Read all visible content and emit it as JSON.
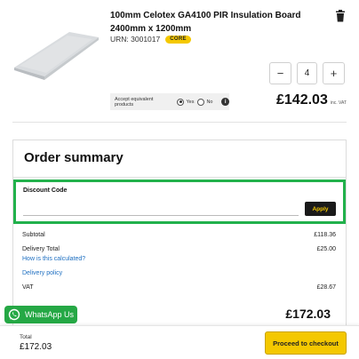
{
  "product": {
    "title": "100mm Celotex GA4100 PIR Insulation Board 2400mm x 1200mm",
    "urn": "URN: 3001017",
    "badge": "CORE",
    "quantity": "4",
    "decrement_label": "−",
    "increment_label": "+",
    "equivalent": {
      "label": "Accept equivalent products",
      "yes": "Yes",
      "no": "No",
      "selected": "Yes",
      "info_glyph": "i"
    },
    "price": "£142.03",
    "price_suffix": "inc. VAT",
    "icons": {
      "delete": "trash-icon",
      "info": "info-icon"
    }
  },
  "summary": {
    "title": "Order summary",
    "discount": {
      "label": "Discount Code",
      "value": "",
      "placeholder": "",
      "apply_label": "Apply"
    },
    "subtotal_label": "Subtotal",
    "subtotal_value": "£118.36",
    "delivery_label": "Delivery Total",
    "delivery_value": "£25.00",
    "delivery_calc_link": "How is this calculated?",
    "delivery_policy_link": "Delivery policy",
    "vat_label": "VAT",
    "vat_value": "£28.67",
    "total": "£172.03"
  },
  "whatsapp": {
    "label": "WhatsApp Us",
    "icon": "whatsapp-icon"
  },
  "footer": {
    "total_label": "Total",
    "total_value": "£172.03",
    "checkout_label": "Proceed to checkout"
  },
  "colors": {
    "accent_yellow": "#f4c800",
    "highlight_green": "#22b14c",
    "whatsapp_green": "#25a845",
    "link_blue": "#1e6fc1"
  }
}
